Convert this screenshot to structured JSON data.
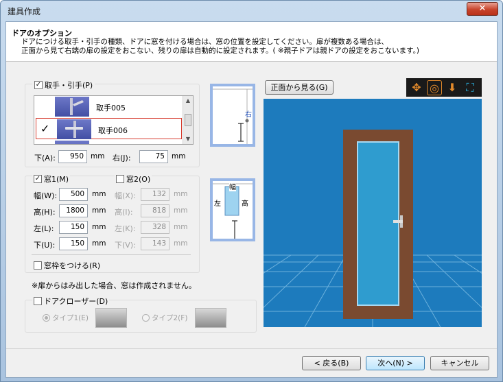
{
  "window": {
    "title": "建具作成",
    "close_symbol": "✕"
  },
  "header": {
    "title": "ドアのオプション",
    "desc_line1": "ドアにつける取手・引手の種類、ドアに窓を付ける場合は、窓の位置を設定してください。扉が複数ある場合は、",
    "desc_line2": "正面から見て右端の扉の設定をおこない、残りの扉は自動的に設定されます。( ※親子ドアは親ドアの設定をおこないます。)"
  },
  "handle": {
    "checkbox_label": "取手・引手(P)",
    "checked": true,
    "items": [
      {
        "name": "取手005",
        "selected": false
      },
      {
        "name": "取手006",
        "selected": true
      }
    ],
    "check_glyph": "✓",
    "bottom_label": "下(A):",
    "bottom_value": "950",
    "right_label": "右(J):",
    "right_value": "75",
    "unit": "mm"
  },
  "window1": {
    "checkbox_label": "窓1(M)",
    "checked": true,
    "fields": [
      {
        "label": "幅(W):",
        "value": "500"
      },
      {
        "label": "高(H):",
        "value": "1800"
      },
      {
        "label": "左(L):",
        "value": "150"
      },
      {
        "label": "下(U):",
        "value": "150"
      }
    ],
    "unit": "mm"
  },
  "window2": {
    "checkbox_label": "窓2(O)",
    "checked": false,
    "fields": [
      {
        "label": "幅(X):",
        "value": "132"
      },
      {
        "label": "高(I):",
        "value": "818"
      },
      {
        "label": "左(K):",
        "value": "328"
      },
      {
        "label": "下(V):",
        "value": "143"
      }
    ],
    "unit": "mm"
  },
  "frame": {
    "checkbox_label": "窓枠をつける(R)",
    "checked": false
  },
  "note": "※扉からはみ出した場合、窓は作成されません。",
  "closer": {
    "checkbox_label": "ドアクローザー(D)",
    "checked": false,
    "type1": "タイプ1(E)",
    "type2": "タイプ2(F)",
    "selected": "type1"
  },
  "diagram_labels": {
    "right": "右",
    "width": "幅",
    "left": "左",
    "height": "高"
  },
  "preview": {
    "front_view_button": "正面から見る(G)"
  },
  "toolbar": {
    "move": "move-icon",
    "rotate": "rotate-icon",
    "zoom": "zoom-icon",
    "fit": "fit-icon"
  },
  "buttons": {
    "back": "< 戻る(B)",
    "next": "次へ(N) >",
    "cancel": "キャンセル"
  },
  "colors": {
    "accent": "#98b6e6",
    "door": "#7a4a30",
    "glass": "#2f9ccf",
    "floor": "#1d7bbd"
  }
}
